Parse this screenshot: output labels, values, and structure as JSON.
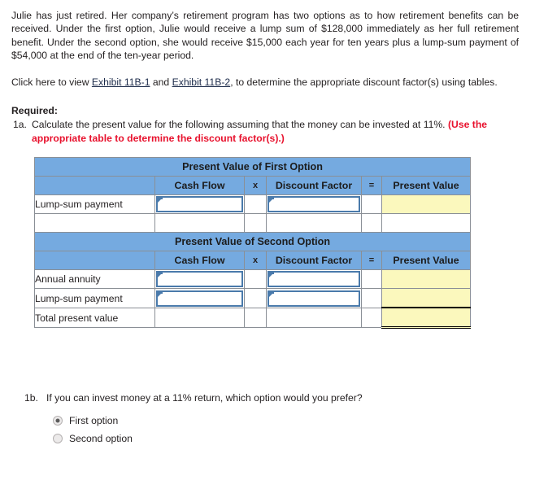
{
  "problem": {
    "paragraph": "Julie has just retired. Her company’s retirement program has two options as to how retirement benefits can be received. Under the first option, Julie would receive a lump sum of $128,000 immediately as her full retirement benefit. Under the second option, she would receive $15,000 each year for ten years plus a lump-sum payment of $54,000 at the end of the ten-year period.",
    "click_prefix": "Click here to view ",
    "exhibit_link_1": "Exhibit 11B-1",
    "click_middle": " and ",
    "exhibit_link_2": "Exhibit 11B-2",
    "click_suffix": ", to determine the appropriate discount factor(s) using tables."
  },
  "required": {
    "label": "Required:",
    "q1a_num": "1a.",
    "q1a_text": "Calculate the present value for the following assuming that the money can be invested at 11%. ",
    "q1a_red": "(Use the appropriate table to determine the discount factor(s).)"
  },
  "worksheet": {
    "columns": {
      "blank": "",
      "cash_flow": "Cash Flow",
      "op_multiply": "x",
      "discount_factor": "Discount Factor",
      "op_equals": "=",
      "present_value": "Present Value"
    },
    "table1": {
      "title": "Present Value of First Option",
      "rows": [
        {
          "label": "Lump-sum payment",
          "cash_flow": "",
          "discount_factor": "",
          "present_value": ""
        },
        {
          "label": "",
          "cash_flow": "",
          "discount_factor": "",
          "present_value": ""
        }
      ]
    },
    "table2": {
      "title": "Present Value of Second Option",
      "rows": [
        {
          "label": "Annual annuity",
          "cash_flow": "",
          "discount_factor": "",
          "present_value": ""
        },
        {
          "label": "Lump-sum payment",
          "cash_flow": "",
          "discount_factor": "",
          "present_value": ""
        },
        {
          "label": "Total present value",
          "cash_flow": "",
          "discount_factor": "",
          "present_value": ""
        }
      ]
    }
  },
  "question_1b": {
    "num": "1b.",
    "text": "If you can invest money at a 11% return, which option would you prefer?",
    "options": [
      {
        "label": "First option",
        "selected": true
      },
      {
        "label": "Second option",
        "selected": false
      }
    ]
  },
  "colors": {
    "header_blue": "#75aae0",
    "input_border": "#4a7aab",
    "answer_yellow": "#fbf8bd",
    "red_note": "#e8112d",
    "grid_line": "#8a8f96"
  }
}
